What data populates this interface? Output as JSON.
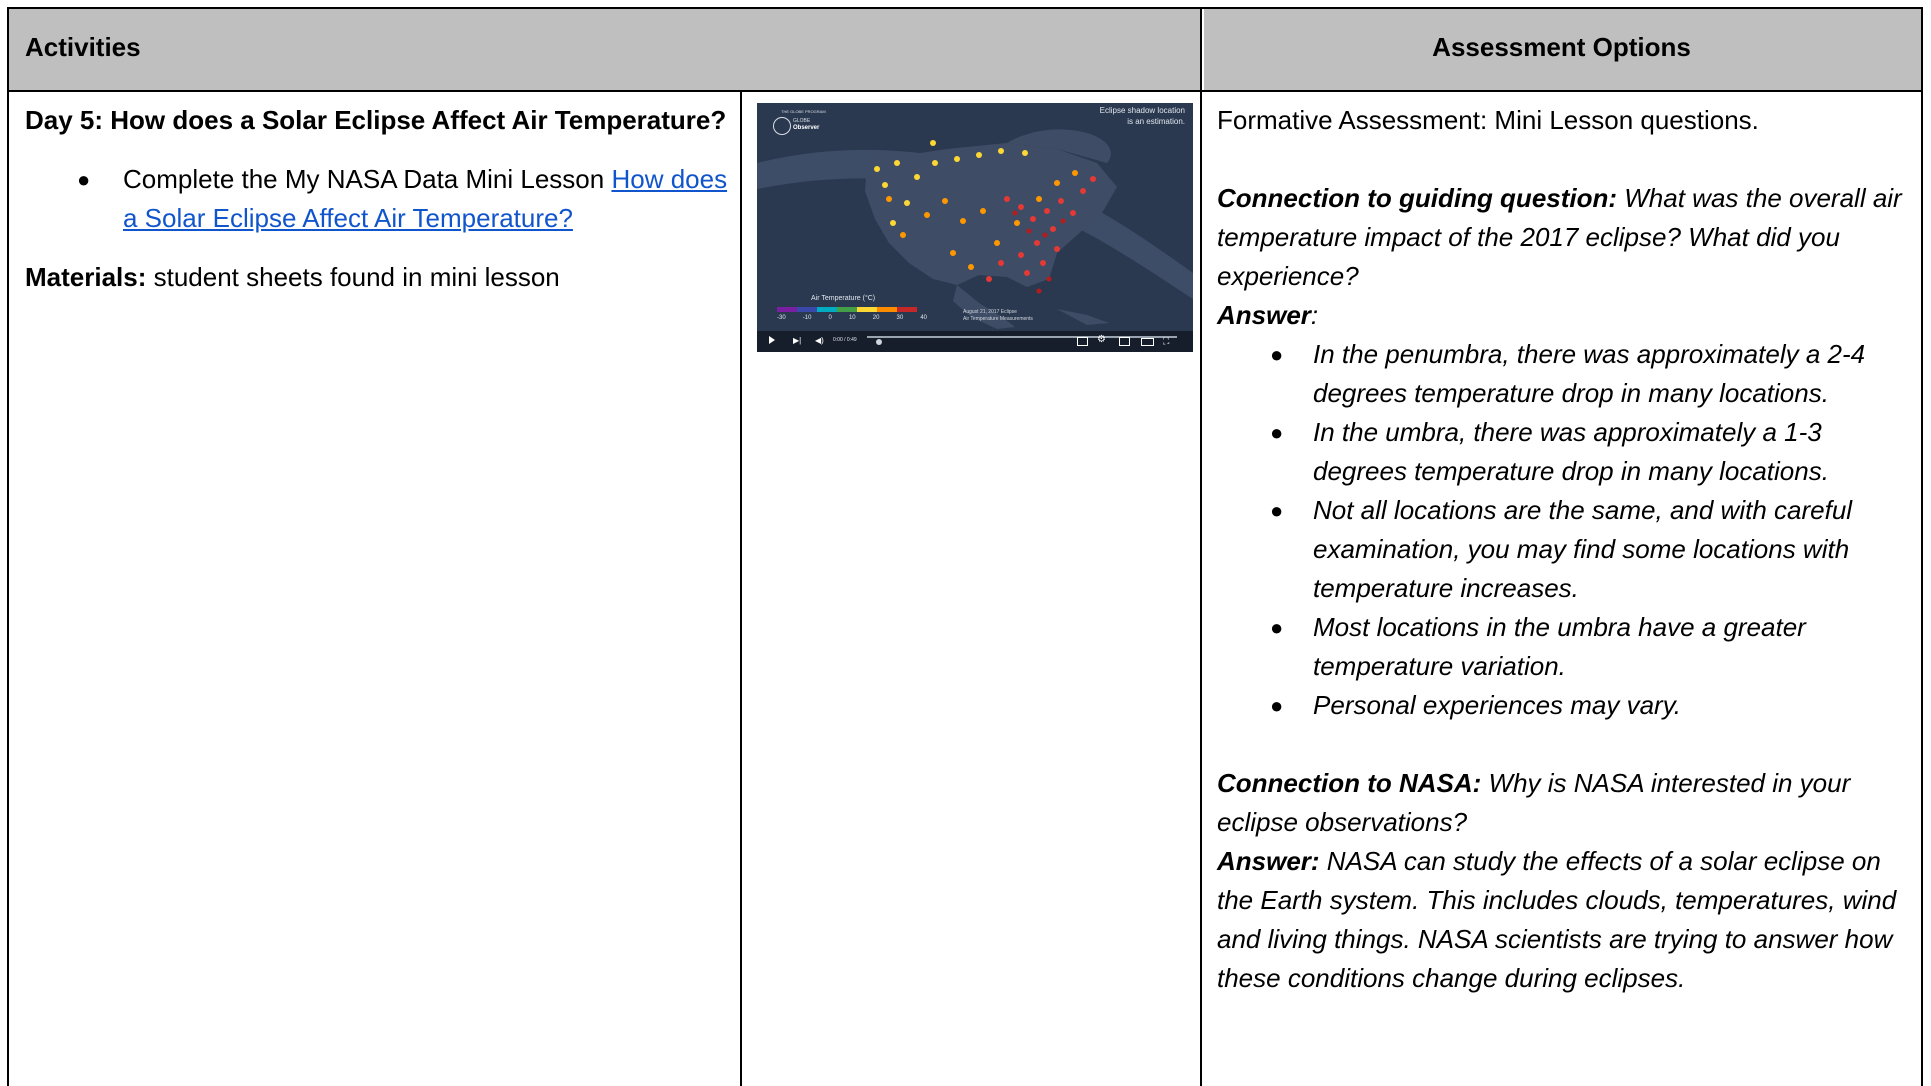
{
  "header": {
    "activities": "Activities",
    "assessment": "Assessment Options"
  },
  "activities": {
    "day_title": "Day 5: How does a Solar Eclipse Affect Air Temperature?",
    "bullet_prefix": "Complete the My NASA Data Mini Lesson ",
    "bullet_link": "How does a Solar Eclipse Affect Air Temperature?",
    "materials_label": "Materials:",
    "materials_text": " student sheets found in mini lesson"
  },
  "video": {
    "brand_small": "THE GLOBE PROGRAM",
    "brand_line1": "GLOBE",
    "brand_line2": "Observer",
    "note_line1": "Eclipse shadow location",
    "note_line2": "is an estimation.",
    "legend_title": "Air Temperature (°C)",
    "legend_ticks": [
      "-30",
      "-10",
      "0",
      "10",
      "20",
      "30",
      "40"
    ],
    "date_line1": "August 21, 2017 Eclipse",
    "date_line2": "Air Temperature Measurements",
    "time": "0:00 / 0:49",
    "colors": {
      "background": "#2c3a52",
      "land": "#3f4d66",
      "path": "#6b7c96"
    },
    "controls": [
      "play-icon",
      "next-icon",
      "volume-icon",
      "captions-icon",
      "settings-icon",
      "miniplayer-icon",
      "theater-icon",
      "fullscreen-icon"
    ]
  },
  "assessment": {
    "formative": "Formative Assessment: Mini Lesson questions.",
    "q1_label": "Connection to guiding question:",
    "q1_text": " What was the overall air temperature impact of the 2017 eclipse? What did you experience?",
    "answer_label": "Answer",
    "answer_colon": ":",
    "answers": [
      "In the penumbra, there was approximately a 2-4 degrees temperature drop in many locations.",
      "In the umbra, there was approximately a 1-3 degrees temperature drop in many locations.",
      "Not all locations are the same, and with careful examination, you may find some locations with temperature increases.",
      "Most locations in the umbra have a greater temperature variation.",
      "Personal experiences may vary."
    ],
    "q2_label": "Connection to NASA:",
    "q2_text": " Why is NASA interested in your eclipse observations?",
    "answer2_label": "Answer:",
    "answer2_text": " NASA can study the effects of a solar eclipse on the Earth system. This includes clouds, temperatures, wind and living things. NASA scientists are trying to answer how these conditions change during eclipses."
  }
}
